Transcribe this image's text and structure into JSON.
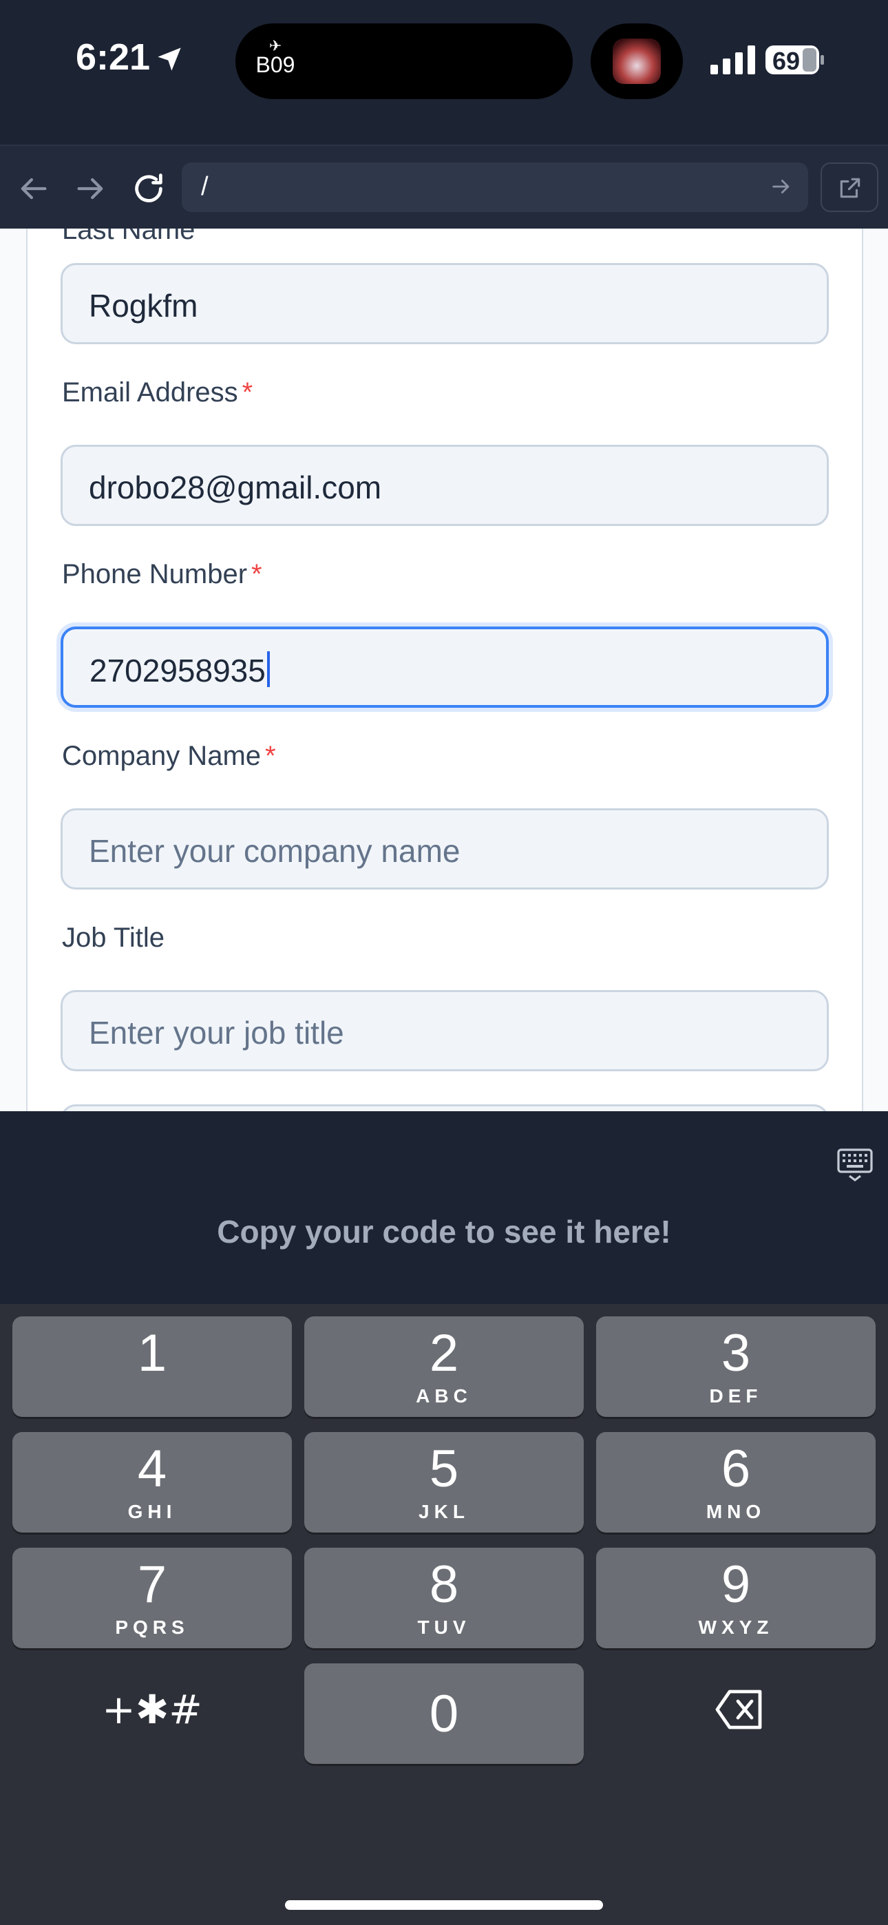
{
  "status_bar": {
    "time": "6:21",
    "location_icon": "location-arrow-icon",
    "live_activity_flight": "B09",
    "live_activity_flight_icon": "plane-icon",
    "battery_level": "69",
    "signal_icon": "cellular-signal-icon"
  },
  "browser": {
    "back_icon": "arrow-left-icon",
    "forward_icon": "arrow-right-icon",
    "reload_icon": "reload-icon",
    "url": "/",
    "go_icon": "arrow-right-icon",
    "open_external_icon": "external-link-icon"
  },
  "form": {
    "partial_label": "Last Name",
    "last_name_value": "Rogkfm",
    "email_label": "Email Address",
    "email_required": "*",
    "email_value": "drobo28@gmail.com",
    "phone_label": "Phone Number",
    "phone_required": "*",
    "phone_value": "2702958935",
    "company_label": "Company Name",
    "company_required": "*",
    "company_placeholder": "Enter your company name",
    "job_label": "Job Title",
    "job_placeholder": "Enter your job title"
  },
  "keyboard_accessory": {
    "keyboard_icon": "keyboard-icon",
    "hint": "Copy your code to see it here!"
  },
  "keypad": {
    "keys": [
      {
        "num": "1",
        "letters": ""
      },
      {
        "num": "2",
        "letters": "ABC"
      },
      {
        "num": "3",
        "letters": "DEF"
      },
      {
        "num": "4",
        "letters": "GHI"
      },
      {
        "num": "5",
        "letters": "JKL"
      },
      {
        "num": "6",
        "letters": "MNO"
      },
      {
        "num": "7",
        "letters": "PQRS"
      },
      {
        "num": "8",
        "letters": "TUV"
      },
      {
        "num": "9",
        "letters": "WXYZ"
      },
      {
        "num": "0",
        "letters": ""
      }
    ],
    "symbols": "+✱#",
    "delete_icon": "backspace-icon"
  },
  "colors": {
    "accent": "#3b82f6",
    "required": "#ef4444",
    "dark_bg": "#1c2333"
  }
}
